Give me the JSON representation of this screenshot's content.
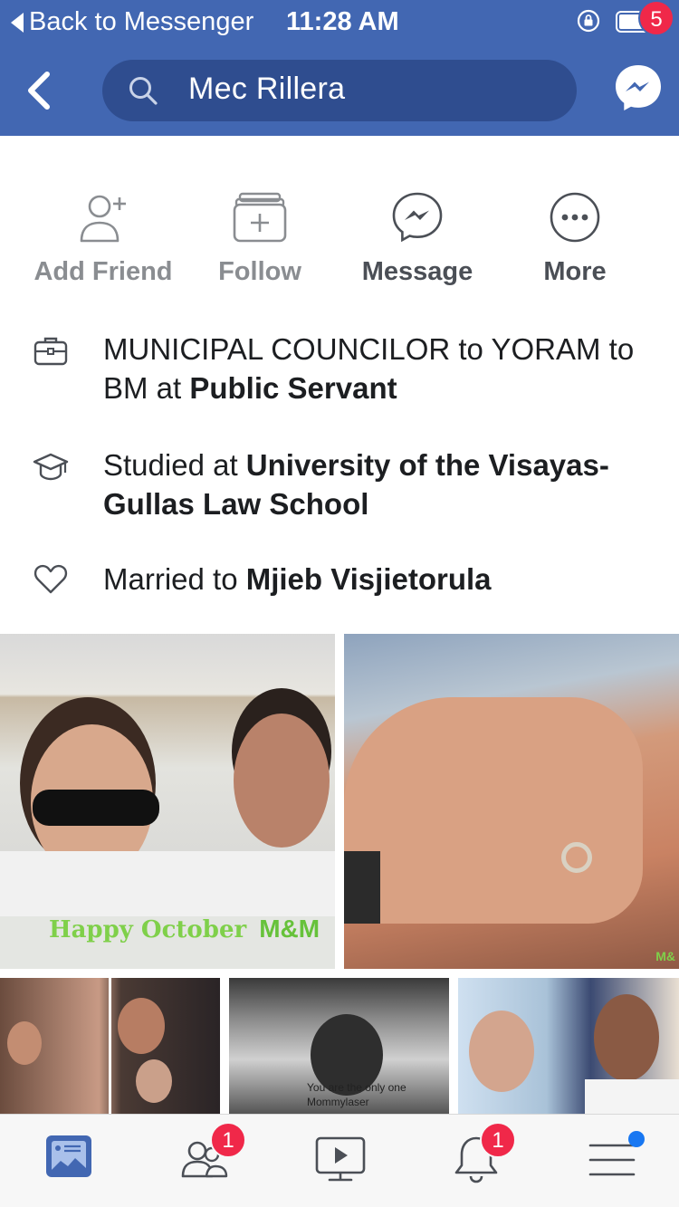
{
  "status_bar": {
    "back_label": "Back to Messenger",
    "time": "11:28 AM"
  },
  "header": {
    "search_value": "Mec Rillera",
    "messenger_badge": "5"
  },
  "actions": [
    {
      "label": "Add Friend",
      "icon": "add-friend-icon"
    },
    {
      "label": "Follow",
      "icon": "follow-icon"
    },
    {
      "label": "Message",
      "icon": "messenger-icon"
    },
    {
      "label": "More",
      "icon": "more-icon"
    }
  ],
  "about": {
    "work": {
      "prefix": "MUNICIPAL COUNCILOR to YORAM to BM at ",
      "place": "Public Servant",
      "icon": "briefcase-icon"
    },
    "education": {
      "prefix": "Studied at ",
      "place": "University of the Visayas-Gullas Law School",
      "icon": "graduation-cap-icon"
    },
    "relationship": {
      "prefix": "Married to ",
      "person": "Mjieb Visjietorula",
      "icon": "heart-icon"
    }
  },
  "photos": {
    "caption_script": "Happy October",
    "caption_initials": "M&M",
    "watermark": "M&",
    "screenshot_text_1": "You are the only one",
    "screenshot_text_2": "Mommylaser"
  },
  "tabbar": {
    "friends_badge": "1",
    "notifications_badge": "1",
    "accent": "#4267b2"
  },
  "colors": {
    "header_bg": "#4267b2",
    "search_bg": "#2f4d8f",
    "badge_red": "#f02849",
    "caption_green": "#7fd04a"
  }
}
